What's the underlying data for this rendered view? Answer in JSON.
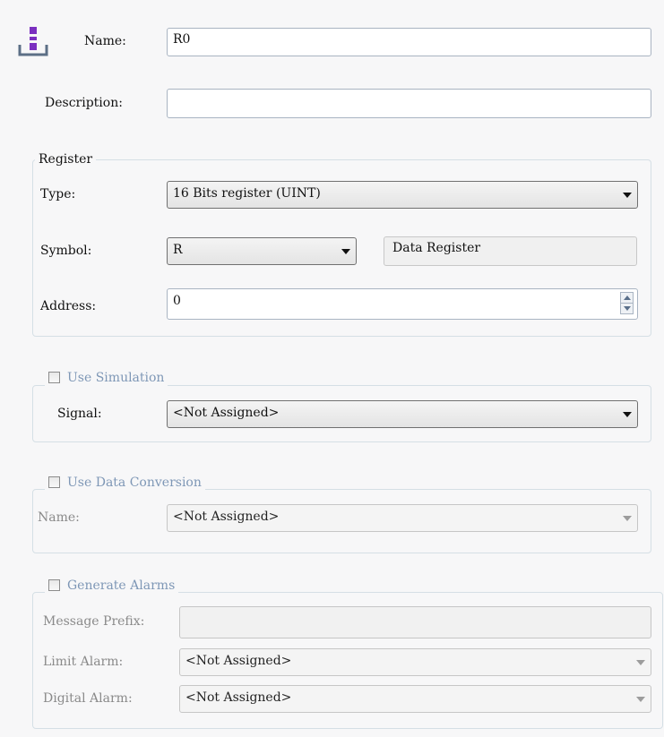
{
  "header": {
    "icon": "register-tag-icon",
    "name_label": "Name:",
    "name_value": "R0",
    "description_label": "Description:",
    "description_value": ""
  },
  "register": {
    "legend": "Register",
    "type_label": "Type:",
    "type_value": "16 Bits register (UINT)",
    "symbol_label": "Symbol:",
    "symbol_value": "R",
    "symbol_description": "Data Register",
    "address_label": "Address:",
    "address_value": "0"
  },
  "simulation": {
    "legend": "Use Simulation",
    "checked": false,
    "signal_label": "Signal:",
    "signal_value": "<Not Assigned>"
  },
  "conversion": {
    "legend": "Use Data Conversion",
    "checked": false,
    "name_label": "Name:",
    "name_value": "<Not Assigned>"
  },
  "alarms": {
    "legend": "Generate Alarms",
    "checked": false,
    "message_prefix_label": "Message Prefix:",
    "message_prefix_value": "",
    "limit_alarm_label": "Limit Alarm:",
    "limit_alarm_value": "<Not Assigned>",
    "digital_alarm_label": "Digital Alarm:",
    "digital_alarm_value": "<Not Assigned>"
  },
  "colors": {
    "icon_purple": "#7b2fc0",
    "legend_blue": "#7e97b6",
    "disabled_text": "#8a8a8a"
  }
}
